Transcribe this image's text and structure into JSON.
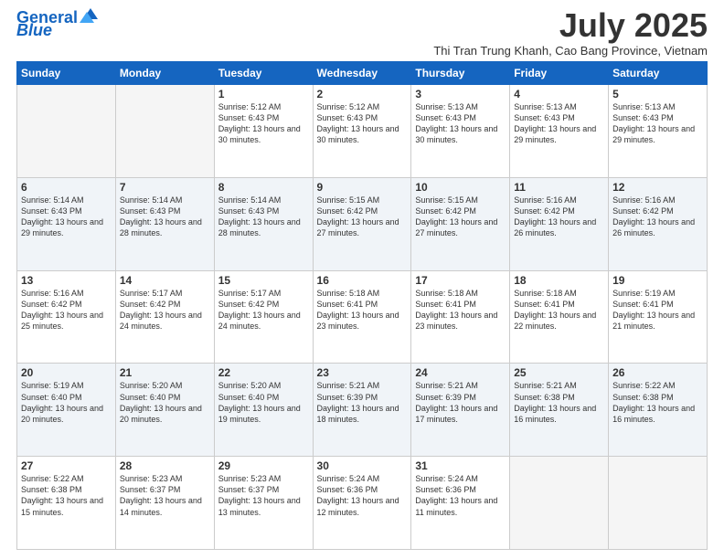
{
  "header": {
    "logo_line1": "General",
    "logo_line2": "Blue",
    "month_title": "July 2025",
    "location": "Thi Tran Trung Khanh, Cao Bang Province, Vietnam"
  },
  "days_of_week": [
    "Sunday",
    "Monday",
    "Tuesday",
    "Wednesday",
    "Thursday",
    "Friday",
    "Saturday"
  ],
  "weeks": [
    [
      {
        "day": "",
        "empty": true
      },
      {
        "day": "",
        "empty": true
      },
      {
        "day": "1",
        "sunrise": "5:12 AM",
        "sunset": "6:43 PM",
        "daylight": "13 hours and 30 minutes."
      },
      {
        "day": "2",
        "sunrise": "5:12 AM",
        "sunset": "6:43 PM",
        "daylight": "13 hours and 30 minutes."
      },
      {
        "day": "3",
        "sunrise": "5:13 AM",
        "sunset": "6:43 PM",
        "daylight": "13 hours and 30 minutes."
      },
      {
        "day": "4",
        "sunrise": "5:13 AM",
        "sunset": "6:43 PM",
        "daylight": "13 hours and 29 minutes."
      },
      {
        "day": "5",
        "sunrise": "5:13 AM",
        "sunset": "6:43 PM",
        "daylight": "13 hours and 29 minutes."
      }
    ],
    [
      {
        "day": "6",
        "sunrise": "5:14 AM",
        "sunset": "6:43 PM",
        "daylight": "13 hours and 29 minutes."
      },
      {
        "day": "7",
        "sunrise": "5:14 AM",
        "sunset": "6:43 PM",
        "daylight": "13 hours and 28 minutes."
      },
      {
        "day": "8",
        "sunrise": "5:14 AM",
        "sunset": "6:43 PM",
        "daylight": "13 hours and 28 minutes."
      },
      {
        "day": "9",
        "sunrise": "5:15 AM",
        "sunset": "6:42 PM",
        "daylight": "13 hours and 27 minutes."
      },
      {
        "day": "10",
        "sunrise": "5:15 AM",
        "sunset": "6:42 PM",
        "daylight": "13 hours and 27 minutes."
      },
      {
        "day": "11",
        "sunrise": "5:16 AM",
        "sunset": "6:42 PM",
        "daylight": "13 hours and 26 minutes."
      },
      {
        "day": "12",
        "sunrise": "5:16 AM",
        "sunset": "6:42 PM",
        "daylight": "13 hours and 26 minutes."
      }
    ],
    [
      {
        "day": "13",
        "sunrise": "5:16 AM",
        "sunset": "6:42 PM",
        "daylight": "13 hours and 25 minutes."
      },
      {
        "day": "14",
        "sunrise": "5:17 AM",
        "sunset": "6:42 PM",
        "daylight": "13 hours and 24 minutes."
      },
      {
        "day": "15",
        "sunrise": "5:17 AM",
        "sunset": "6:42 PM",
        "daylight": "13 hours and 24 minutes."
      },
      {
        "day": "16",
        "sunrise": "5:18 AM",
        "sunset": "6:41 PM",
        "daylight": "13 hours and 23 minutes."
      },
      {
        "day": "17",
        "sunrise": "5:18 AM",
        "sunset": "6:41 PM",
        "daylight": "13 hours and 23 minutes."
      },
      {
        "day": "18",
        "sunrise": "5:18 AM",
        "sunset": "6:41 PM",
        "daylight": "13 hours and 22 minutes."
      },
      {
        "day": "19",
        "sunrise": "5:19 AM",
        "sunset": "6:41 PM",
        "daylight": "13 hours and 21 minutes."
      }
    ],
    [
      {
        "day": "20",
        "sunrise": "5:19 AM",
        "sunset": "6:40 PM",
        "daylight": "13 hours and 20 minutes."
      },
      {
        "day": "21",
        "sunrise": "5:20 AM",
        "sunset": "6:40 PM",
        "daylight": "13 hours and 20 minutes."
      },
      {
        "day": "22",
        "sunrise": "5:20 AM",
        "sunset": "6:40 PM",
        "daylight": "13 hours and 19 minutes."
      },
      {
        "day": "23",
        "sunrise": "5:21 AM",
        "sunset": "6:39 PM",
        "daylight": "13 hours and 18 minutes."
      },
      {
        "day": "24",
        "sunrise": "5:21 AM",
        "sunset": "6:39 PM",
        "daylight": "13 hours and 17 minutes."
      },
      {
        "day": "25",
        "sunrise": "5:21 AM",
        "sunset": "6:38 PM",
        "daylight": "13 hours and 16 minutes."
      },
      {
        "day": "26",
        "sunrise": "5:22 AM",
        "sunset": "6:38 PM",
        "daylight": "13 hours and 16 minutes."
      }
    ],
    [
      {
        "day": "27",
        "sunrise": "5:22 AM",
        "sunset": "6:38 PM",
        "daylight": "13 hours and 15 minutes."
      },
      {
        "day": "28",
        "sunrise": "5:23 AM",
        "sunset": "6:37 PM",
        "daylight": "13 hours and 14 minutes."
      },
      {
        "day": "29",
        "sunrise": "5:23 AM",
        "sunset": "6:37 PM",
        "daylight": "13 hours and 13 minutes."
      },
      {
        "day": "30",
        "sunrise": "5:24 AM",
        "sunset": "6:36 PM",
        "daylight": "13 hours and 12 minutes."
      },
      {
        "day": "31",
        "sunrise": "5:24 AM",
        "sunset": "6:36 PM",
        "daylight": "13 hours and 11 minutes."
      },
      {
        "day": "",
        "empty": true
      },
      {
        "day": "",
        "empty": true
      }
    ]
  ]
}
